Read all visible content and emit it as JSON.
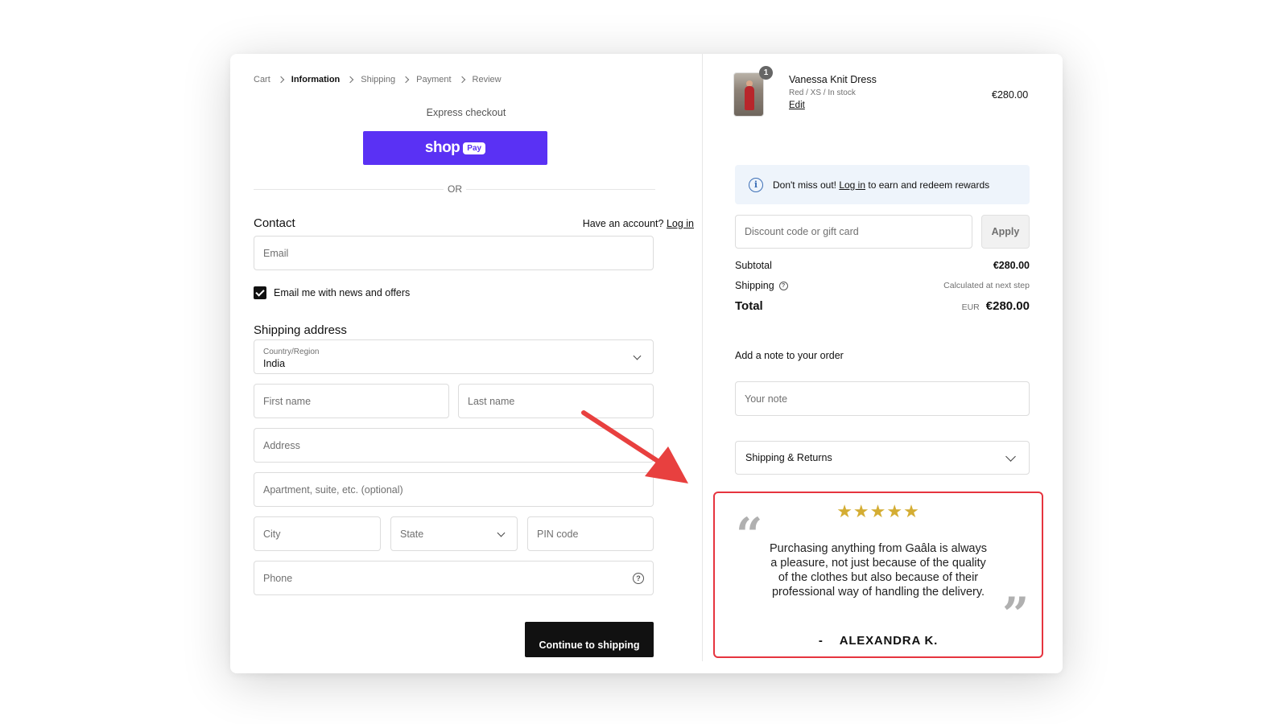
{
  "breadcrumb": [
    "Cart",
    "Information",
    "Shipping",
    "Payment",
    "Review"
  ],
  "breadcrumb_active": "Information",
  "express": {
    "label": "Express checkout",
    "shop_word": "shop",
    "pay_word": "Pay",
    "or": "OR"
  },
  "contact": {
    "title": "Contact",
    "have_account": "Have an account?",
    "login": "Log in",
    "email_placeholder": "Email",
    "newsletter_label": "Email me with news and offers",
    "newsletter_checked": true
  },
  "shipping_address": {
    "title": "Shipping address",
    "country_label": "Country/Region",
    "country_value": "India",
    "first_name": "First name",
    "last_name": "Last name",
    "address": "Address",
    "apartment": "Apartment, suite, etc. (optional)",
    "city": "City",
    "state": "State",
    "pin": "PIN code",
    "phone": "Phone"
  },
  "continue_label": "Continue to shipping",
  "product": {
    "qty": "1",
    "name": "Vanessa Knit Dress",
    "meta": "Red / XS / In stock",
    "edit": "Edit",
    "price": "€280.00"
  },
  "rewards": {
    "prefix": "Don't miss out!",
    "login": "Log in",
    "suffix": "to earn and redeem rewards"
  },
  "discount": {
    "placeholder": "Discount code or gift card",
    "apply": "Apply"
  },
  "summary": {
    "subtotal_label": "Subtotal",
    "subtotal_value": "€280.00",
    "shipping_label": "Shipping",
    "shipping_value": "Calculated at next step",
    "total_label": "Total",
    "currency": "EUR",
    "total_value": "€280.00"
  },
  "note": {
    "label": "Add a note to your order",
    "placeholder": "Your note"
  },
  "accordion_label": "Shipping & Returns",
  "review": {
    "stars": "★★★★★",
    "rating": 5,
    "text": "Purchasing anything from Gaâla is always a pleasure, not just because of the quality of the clothes but also because of their professional way of handling the delivery.",
    "author_dash": "-",
    "author": "ALEXANDRA K."
  },
  "colors": {
    "shop_pay": "#5a31f4",
    "highlight_border": "#e6343f",
    "arrow": "#e8403f",
    "stars": "#d4ad33",
    "rewards_bg": "#eef4fb"
  }
}
